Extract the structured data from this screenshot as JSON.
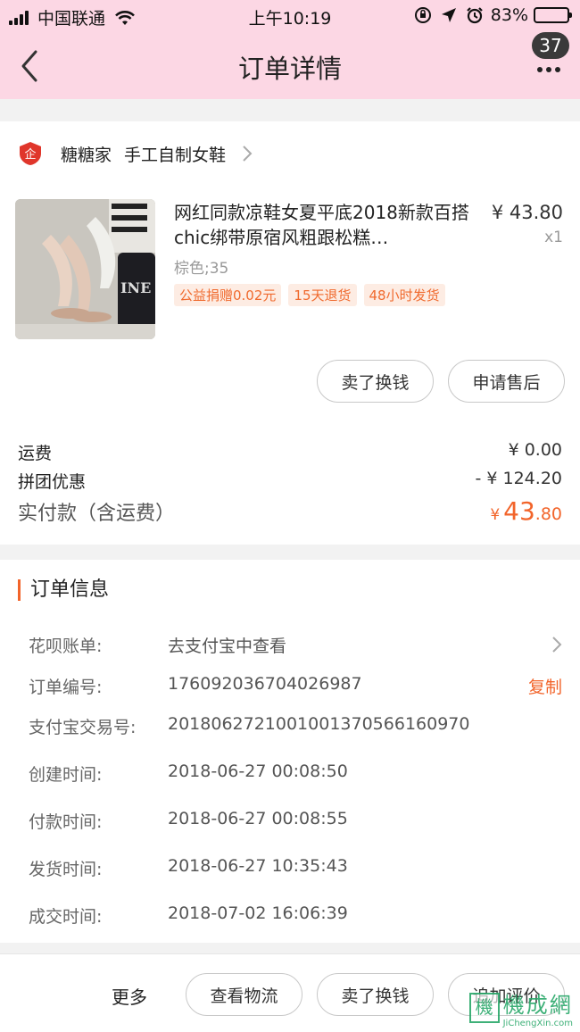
{
  "status_bar": {
    "carrier": "中国联通",
    "time": "上午10:19",
    "battery": "83%",
    "battery_level": 0.83
  },
  "nav": {
    "title": "订单详情",
    "badge_count": "37",
    "back_icon": "chevron-left-icon",
    "more_icon": "more-dots-icon"
  },
  "shop": {
    "name": "糖糖家",
    "subtitle": "手工自制女鞋",
    "logo_text": "企"
  },
  "product": {
    "title": "网红同款凉鞋女夏平底2018新款百搭chic绑带原宿风粗跟松糕…",
    "price": "¥ 43.80",
    "qty": "x1",
    "sku": "棕色;35",
    "tags": [
      "公益捐赠0.02元",
      "15天退货",
      "48小时发货"
    ],
    "image_text": "INE"
  },
  "actions": {
    "sell": "卖了换钱",
    "after_sale": "申请售后"
  },
  "fees": {
    "shipping_label": "运费",
    "shipping_value": "¥ 0.00",
    "group_label": "拼团优惠",
    "group_value": "- ¥ 124.20",
    "paid_label": "实付款（含运费）",
    "paid_currency": "¥",
    "paid_int": "43",
    "paid_dec": ".80"
  },
  "order_info": {
    "title": "订单信息",
    "rows": [
      {
        "label": "花呗账单:",
        "value": "去支付宝中查看"
      },
      {
        "label": "订单编号:",
        "value": "176092036704026987",
        "action": "复制"
      },
      {
        "label": "支付宝交易号:",
        "value": "2018062721001001370566160970"
      },
      {
        "label": "创建时间:",
        "value": "2018-06-27 00:08:50"
      },
      {
        "label": "付款时间:",
        "value": "2018-06-27 00:08:55"
      },
      {
        "label": "发货时间:",
        "value": "2018-06-27 10:35:43"
      },
      {
        "label": "成交时间:",
        "value": "2018-07-02 16:06:39"
      }
    ]
  },
  "bottom": {
    "more": "更多",
    "logistics": "查看物流",
    "sell": "卖了换钱",
    "review": "追加评价"
  },
  "watermark": {
    "logo": "機",
    "cn": "機成網",
    "en": "JiChengXin.com"
  },
  "colors": {
    "header_bg": "#fcd7e4",
    "accent": "#f2642a",
    "shop_logo": "#e0362b"
  }
}
